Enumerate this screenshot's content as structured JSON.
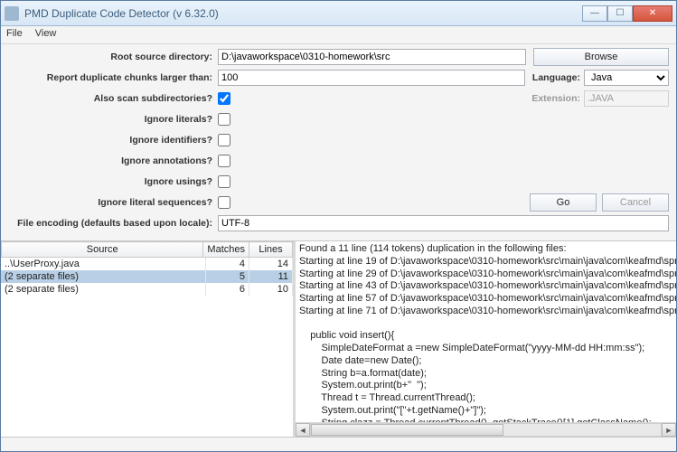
{
  "title": "PMD Duplicate Code Detector (v 6.32.0)",
  "menu": {
    "file": "File",
    "view": "View"
  },
  "form": {
    "root_label": "Root source directory:",
    "root_value": "D:\\javaworkspace\\0310-homework\\src",
    "browse": "Browse",
    "chunk_label": "Report duplicate chunks larger than:",
    "chunk_value": "100",
    "lang_label": "Language:",
    "lang_value": "Java",
    "subdir_label": "Also scan subdirectories?",
    "ext_label": "Extension:",
    "ext_value": ".JAVA",
    "lit_label": "Ignore literals?",
    "ident_label": "Ignore identifiers?",
    "annot_label": "Ignore annotations?",
    "using_label": "Ignore usings?",
    "litseq_label": "Ignore literal sequences?",
    "go": "Go",
    "cancel": "Cancel",
    "enc_label": "File encoding (defaults based upon locale):",
    "enc_value": "UTF-8"
  },
  "table": {
    "h_source": "Source",
    "h_matches": "Matches",
    "h_lines": "Lines",
    "rows": [
      {
        "source": "..\\UserProxy.java",
        "matches": "4",
        "lines": "14"
      },
      {
        "source": "(2 separate files)",
        "matches": "5",
        "lines": "11"
      },
      {
        "source": "(2 separate files)",
        "matches": "6",
        "lines": "10"
      }
    ]
  },
  "details": "Found a 11 line (114 tokens) duplication in the following files:\nStarting at line 19 of D:\\javaworkspace\\0310-homework\\src\\main\\java\\com\\keafmd\\spring\\aop\\User.java\nStarting at line 29 of D:\\javaworkspace\\0310-homework\\src\\main\\java\\com\\keafmd\\spring\\aop\\UserProxy.ja\nStarting at line 43 of D:\\javaworkspace\\0310-homework\\src\\main\\java\\com\\keafmd\\spring\\aop\\UserProxy.ja\nStarting at line 57 of D:\\javaworkspace\\0310-homework\\src\\main\\java\\com\\keafmd\\spring\\aop\\UserProxy.ja\nStarting at line 71 of D:\\javaworkspace\\0310-homework\\src\\main\\java\\com\\keafmd\\spring\\aop\\UserProxy.ja\n\n    public void insert(){\n        SimpleDateFormat a =new SimpleDateFormat(\"yyyy-MM-dd HH:mm:ss\");\n        Date date=new Date();\n        String b=a.format(date);\n        System.out.print(b+\"  \");\n        Thread t = Thread.currentThread();\n        System.out.print(\"[\"+t.getName()+\"]\");\n        String clazz = Thread.currentThread() .getStackTrace()[1].getClassName();\n        String method = Thread.currentThread() .getStackTrace()[1].getMethodName();\n        System.out.println( \" \"+clazz + \" \" + method);\n    }"
}
